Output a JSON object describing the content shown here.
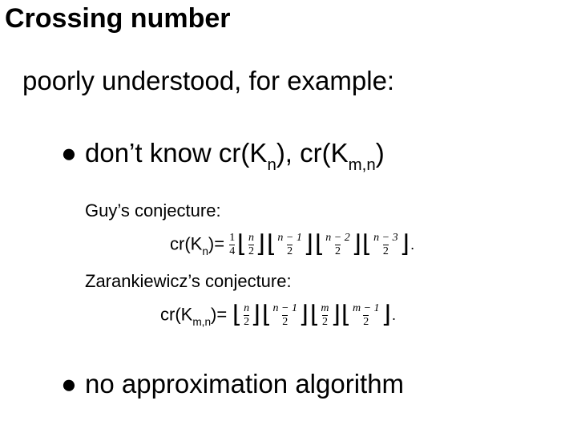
{
  "title": "Crossing number",
  "subtitle": "poorly understood, for example:",
  "bullets": {
    "dot": "●",
    "b1_pre": "don’t know cr(K",
    "b1_s1": "n",
    "b1_mid": "), cr(K",
    "b1_s2": "m,n",
    "b1_post": ")",
    "b2": "no approximation algorithm"
  },
  "conjectures": {
    "guy_label": "Guy’s conjecture:",
    "guy_lhs_pre": "cr(K",
    "guy_lhs_sub": "n",
    "guy_lhs_post": ")=",
    "zar_label": "Zarankiewicz’s conjecture:",
    "zar_lhs_pre": "cr(K",
    "zar_lhs_sub": "m,n",
    "zar_lhs_post": ")="
  },
  "chart_data": [
    {
      "type": "table",
      "title": "Guy's conjecture formula cr(K_n) = (1/4) · floor(n/2) · floor((n-1)/2) · floor((n-2)/2) · floor((n-3)/2)",
      "lead_numer": "1",
      "lead_denom": "4",
      "terms": [
        {
          "numer": "n",
          "denom": "2"
        },
        {
          "numer": "n − 1",
          "denom": "2"
        },
        {
          "numer": "n − 2",
          "denom": "2"
        },
        {
          "numer": "n − 3",
          "denom": "2"
        }
      ],
      "trail": "."
    },
    {
      "type": "table",
      "title": "Zarankiewicz's conjecture formula cr(K_{m,n}) = floor(n/2) · floor((n-1)/2) · floor(m/2) · floor((m-1)/2)",
      "terms": [
        {
          "numer": "n",
          "denom": "2"
        },
        {
          "numer": "n − 1",
          "denom": "2"
        },
        {
          "numer": "m",
          "denom": "2"
        },
        {
          "numer": "m − 1",
          "denom": "2"
        }
      ],
      "trail": "."
    }
  ]
}
